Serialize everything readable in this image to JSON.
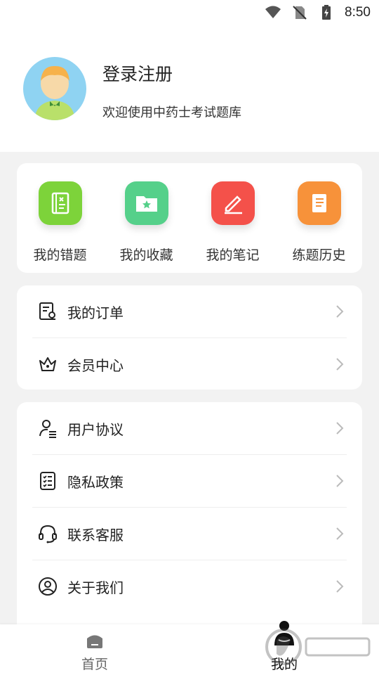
{
  "status_bar": {
    "time": "8:50"
  },
  "profile": {
    "title": "登录注册",
    "subtitle": "欢迎使用中药士考试题库"
  },
  "quick_actions": [
    {
      "label": "我的错题",
      "icon": "notebook-icon",
      "color": "#7dd33a"
    },
    {
      "label": "我的收藏",
      "icon": "folder-star-icon",
      "color": "#55d08a"
    },
    {
      "label": "我的笔记",
      "icon": "pen-edit-icon",
      "color": "#f4514a"
    },
    {
      "label": "练题历史",
      "icon": "scroll-icon",
      "color": "#f7923a"
    }
  ],
  "menu_group_1": [
    {
      "label": "我的订单",
      "icon": "order-list-icon"
    },
    {
      "label": "会员中心",
      "icon": "crown-icon"
    }
  ],
  "menu_group_2": [
    {
      "label": "用户协议",
      "icon": "user-agreement-icon"
    },
    {
      "label": "隐私政策",
      "icon": "privacy-checklist-icon"
    },
    {
      "label": "联系客服",
      "icon": "headset-icon"
    },
    {
      "label": "关于我们",
      "icon": "about-user-icon"
    }
  ],
  "bottom_nav": [
    {
      "label": "首页",
      "icon": "home-icon",
      "active": false,
      "color": "#666666"
    },
    {
      "label": "我的",
      "icon": "profile-icon",
      "active": true,
      "color": "#111111"
    }
  ]
}
